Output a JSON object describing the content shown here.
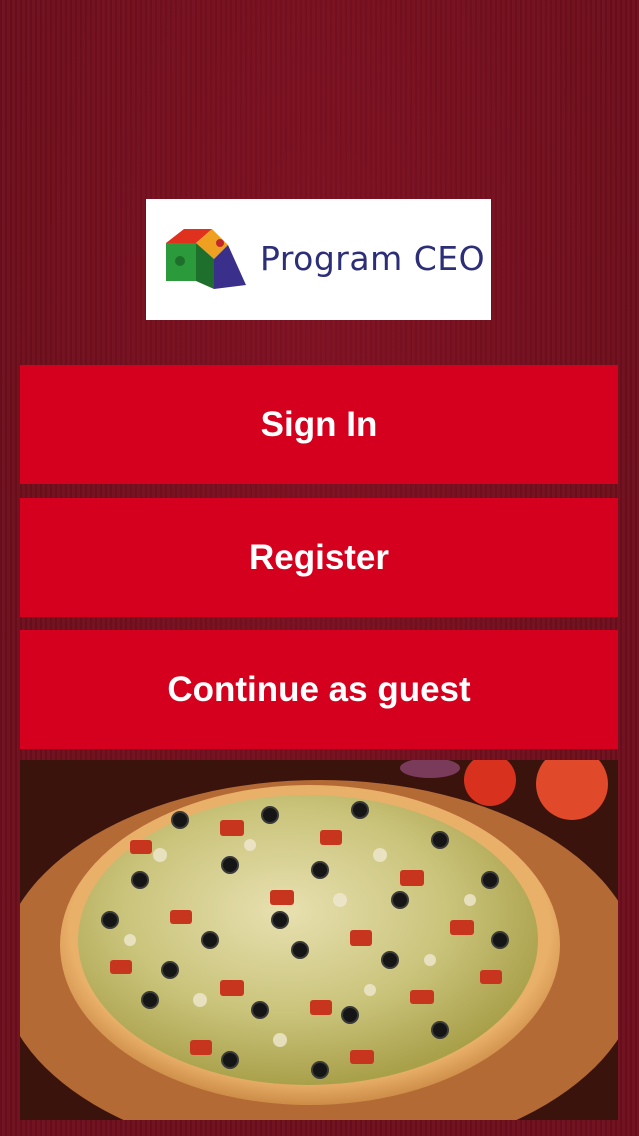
{
  "brand": {
    "name": "Program CEO"
  },
  "buttons": {
    "sign_in": "Sign In",
    "register": "Register",
    "guest": "Continue as guest"
  },
  "colors": {
    "background": "#6e0e1c",
    "button": "#d4001d",
    "logo_text": "#2c2f78"
  },
  "images": {
    "hero": "pizza-photo"
  }
}
